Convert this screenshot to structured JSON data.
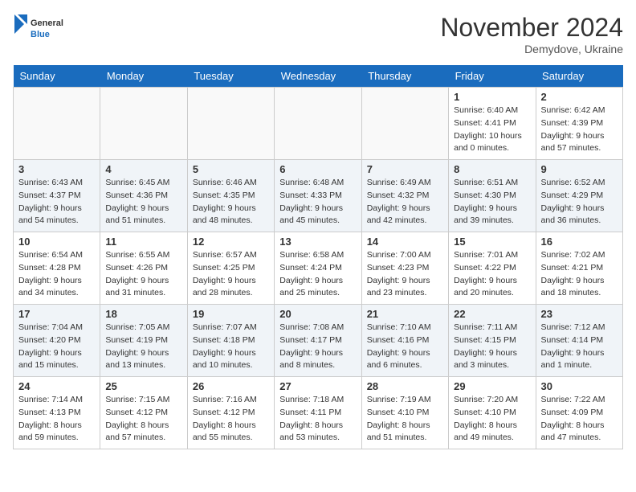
{
  "header": {
    "logo": {
      "general": "General",
      "blue": "Blue"
    },
    "title": "November 2024",
    "location": "Demydove, Ukraine"
  },
  "weekdays": [
    "Sunday",
    "Monday",
    "Tuesday",
    "Wednesday",
    "Thursday",
    "Friday",
    "Saturday"
  ],
  "weeks": [
    [
      {
        "day": "",
        "info": ""
      },
      {
        "day": "",
        "info": ""
      },
      {
        "day": "",
        "info": ""
      },
      {
        "day": "",
        "info": ""
      },
      {
        "day": "",
        "info": ""
      },
      {
        "day": "1",
        "info": "Sunrise: 6:40 AM\nSunset: 4:41 PM\nDaylight: 10 hours\nand 0 minutes."
      },
      {
        "day": "2",
        "info": "Sunrise: 6:42 AM\nSunset: 4:39 PM\nDaylight: 9 hours\nand 57 minutes."
      }
    ],
    [
      {
        "day": "3",
        "info": "Sunrise: 6:43 AM\nSunset: 4:37 PM\nDaylight: 9 hours\nand 54 minutes."
      },
      {
        "day": "4",
        "info": "Sunrise: 6:45 AM\nSunset: 4:36 PM\nDaylight: 9 hours\nand 51 minutes."
      },
      {
        "day": "5",
        "info": "Sunrise: 6:46 AM\nSunset: 4:35 PM\nDaylight: 9 hours\nand 48 minutes."
      },
      {
        "day": "6",
        "info": "Sunrise: 6:48 AM\nSunset: 4:33 PM\nDaylight: 9 hours\nand 45 minutes."
      },
      {
        "day": "7",
        "info": "Sunrise: 6:49 AM\nSunset: 4:32 PM\nDaylight: 9 hours\nand 42 minutes."
      },
      {
        "day": "8",
        "info": "Sunrise: 6:51 AM\nSunset: 4:30 PM\nDaylight: 9 hours\nand 39 minutes."
      },
      {
        "day": "9",
        "info": "Sunrise: 6:52 AM\nSunset: 4:29 PM\nDaylight: 9 hours\nand 36 minutes."
      }
    ],
    [
      {
        "day": "10",
        "info": "Sunrise: 6:54 AM\nSunset: 4:28 PM\nDaylight: 9 hours\nand 34 minutes."
      },
      {
        "day": "11",
        "info": "Sunrise: 6:55 AM\nSunset: 4:26 PM\nDaylight: 9 hours\nand 31 minutes."
      },
      {
        "day": "12",
        "info": "Sunrise: 6:57 AM\nSunset: 4:25 PM\nDaylight: 9 hours\nand 28 minutes."
      },
      {
        "day": "13",
        "info": "Sunrise: 6:58 AM\nSunset: 4:24 PM\nDaylight: 9 hours\nand 25 minutes."
      },
      {
        "day": "14",
        "info": "Sunrise: 7:00 AM\nSunset: 4:23 PM\nDaylight: 9 hours\nand 23 minutes."
      },
      {
        "day": "15",
        "info": "Sunrise: 7:01 AM\nSunset: 4:22 PM\nDaylight: 9 hours\nand 20 minutes."
      },
      {
        "day": "16",
        "info": "Sunrise: 7:02 AM\nSunset: 4:21 PM\nDaylight: 9 hours\nand 18 minutes."
      }
    ],
    [
      {
        "day": "17",
        "info": "Sunrise: 7:04 AM\nSunset: 4:20 PM\nDaylight: 9 hours\nand 15 minutes."
      },
      {
        "day": "18",
        "info": "Sunrise: 7:05 AM\nSunset: 4:19 PM\nDaylight: 9 hours\nand 13 minutes."
      },
      {
        "day": "19",
        "info": "Sunrise: 7:07 AM\nSunset: 4:18 PM\nDaylight: 9 hours\nand 10 minutes."
      },
      {
        "day": "20",
        "info": "Sunrise: 7:08 AM\nSunset: 4:17 PM\nDaylight: 9 hours\nand 8 minutes."
      },
      {
        "day": "21",
        "info": "Sunrise: 7:10 AM\nSunset: 4:16 PM\nDaylight: 9 hours\nand 6 minutes."
      },
      {
        "day": "22",
        "info": "Sunrise: 7:11 AM\nSunset: 4:15 PM\nDaylight: 9 hours\nand 3 minutes."
      },
      {
        "day": "23",
        "info": "Sunrise: 7:12 AM\nSunset: 4:14 PM\nDaylight: 9 hours\nand 1 minute."
      }
    ],
    [
      {
        "day": "24",
        "info": "Sunrise: 7:14 AM\nSunset: 4:13 PM\nDaylight: 8 hours\nand 59 minutes."
      },
      {
        "day": "25",
        "info": "Sunrise: 7:15 AM\nSunset: 4:12 PM\nDaylight: 8 hours\nand 57 minutes."
      },
      {
        "day": "26",
        "info": "Sunrise: 7:16 AM\nSunset: 4:12 PM\nDaylight: 8 hours\nand 55 minutes."
      },
      {
        "day": "27",
        "info": "Sunrise: 7:18 AM\nSunset: 4:11 PM\nDaylight: 8 hours\nand 53 minutes."
      },
      {
        "day": "28",
        "info": "Sunrise: 7:19 AM\nSunset: 4:10 PM\nDaylight: 8 hours\nand 51 minutes."
      },
      {
        "day": "29",
        "info": "Sunrise: 7:20 AM\nSunset: 4:10 PM\nDaylight: 8 hours\nand 49 minutes."
      },
      {
        "day": "30",
        "info": "Sunrise: 7:22 AM\nSunset: 4:09 PM\nDaylight: 8 hours\nand 47 minutes."
      }
    ]
  ]
}
